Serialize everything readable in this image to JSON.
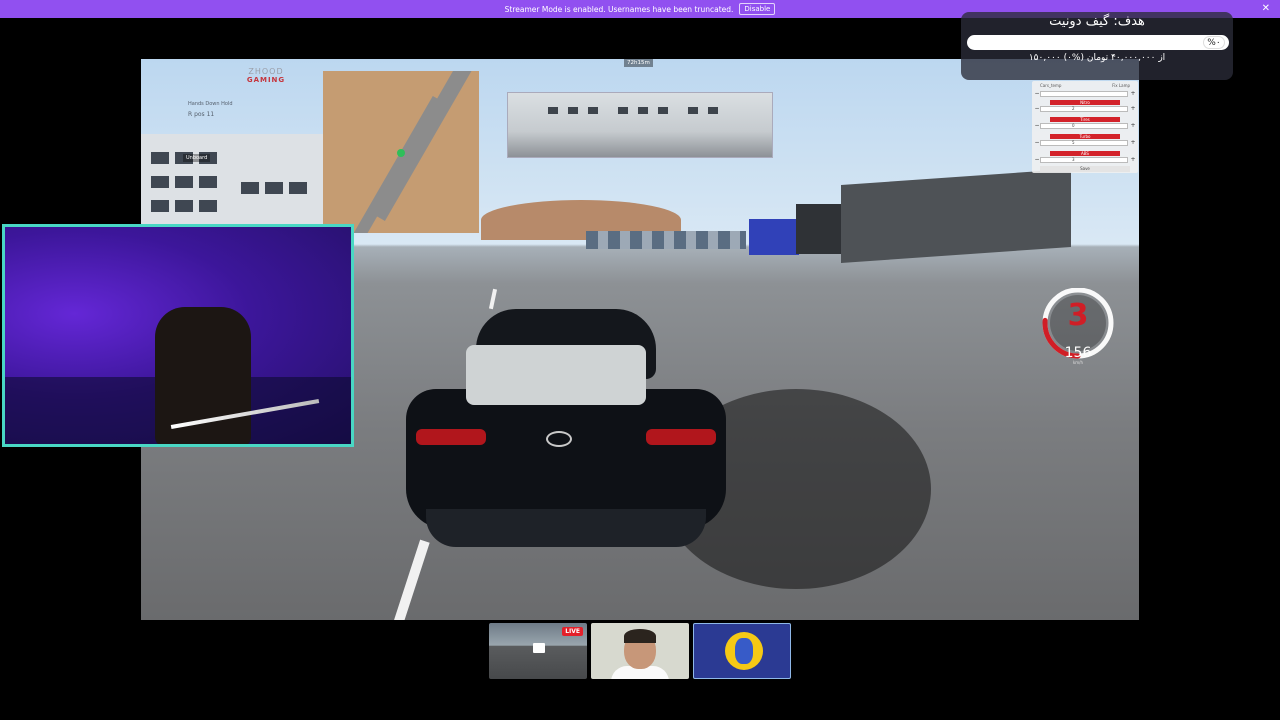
{
  "banner": {
    "message": "Streamer Mode is enabled. Usernames have been truncated.",
    "disable_label": "Disable",
    "close_icon": "✕"
  },
  "game": {
    "logo_line1": "ZHOOD",
    "logo_line2": "GAMING",
    "hud_line1": "Hands Down Hold",
    "hud_line2": "R pos  11",
    "hud_tag": "Unboard",
    "timer": "72h15m",
    "tuning": {
      "rows": [
        {
          "label": "Nitro",
          "value": "2"
        },
        {
          "label": "Tires",
          "value": "0"
        },
        {
          "label": "Turbo",
          "value": "5"
        },
        {
          "label": "ABS",
          "value": "3"
        }
      ],
      "footer": "Save",
      "header_left": "Cars_temp",
      "header_right": "Fix  Lamp"
    },
    "speedometer": {
      "gear": "3",
      "speed": "156",
      "unit": "km/h",
      "level": 0.75
    }
  },
  "donation": {
    "title": "هدف: گیف دونیت",
    "percent": "%۰",
    "amount": "۱۵۰,۰۰۰ از ۴۰,۰۰۰,۰۰۰ تومان (%۰)",
    "progress": 0
  },
  "thumbnails": [
    {
      "name": "stream-preview",
      "badge": "LIVE"
    },
    {
      "name": "host-avatar",
      "badge": ""
    },
    {
      "name": "bot-avatar",
      "badge": ""
    }
  ],
  "colors": {
    "banner": "#9150f0",
    "webcam_border": "#49d7c4",
    "speed_red": "#d01e26",
    "live_red": "#e4202a"
  }
}
